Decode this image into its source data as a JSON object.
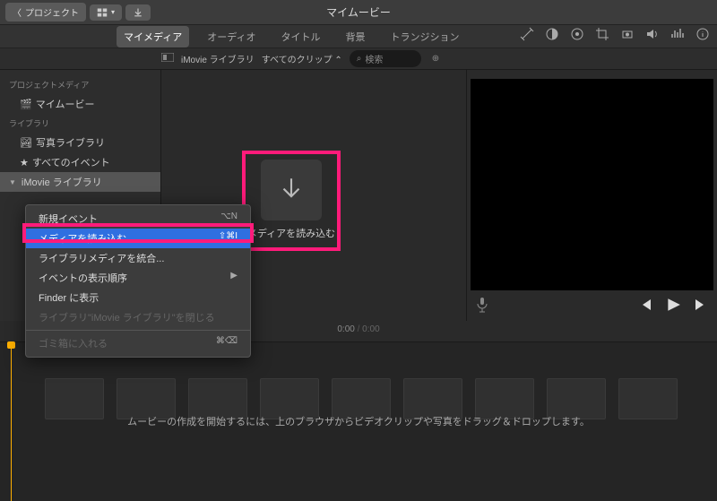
{
  "topbar": {
    "back_label": "プロジェクト",
    "title": "マイムービー"
  },
  "tabs": {
    "my_media": "マイメディア",
    "audio": "オーディオ",
    "titles": "タイトル",
    "backgrounds": "背景",
    "transitions": "トランジション"
  },
  "filterbar": {
    "library_name": "iMovie ライブラリ",
    "clips_filter": "すべてのクリップ",
    "search_placeholder": "検索"
  },
  "sidebar": {
    "project_media_header": "プロジェクトメディア",
    "my_movie": "マイムービー",
    "library_header": "ライブラリ",
    "photos_library": "写真ライブラリ",
    "all_events": "すべてのイベント",
    "imovie_library": "iMovie ライブラリ"
  },
  "import_box": {
    "label": "メディアを読み込む"
  },
  "preview": {
    "current_time": "0:00",
    "total_time": "0:00"
  },
  "timeline": {
    "hint": "ムービーの作成を開始するには、上のブラウザからビデオクリップや写真をドラッグ＆ドロップします。"
  },
  "context_menu": {
    "new_event": "新規イベント",
    "new_event_sc": "⌥N",
    "import_media": "メディアを読み込む...",
    "import_media_sc": "⇧⌘I",
    "consolidate": "ライブラリメディアを統合...",
    "sort_events": "イベントの表示順序",
    "reveal_in_finder": "Finder に表示",
    "close_library": "ライブラリ\"iMovie ライブラリ\"を閉じる",
    "move_to_trash": "ゴミ箱に入れる",
    "move_to_trash_sc": "⌘⌫"
  }
}
